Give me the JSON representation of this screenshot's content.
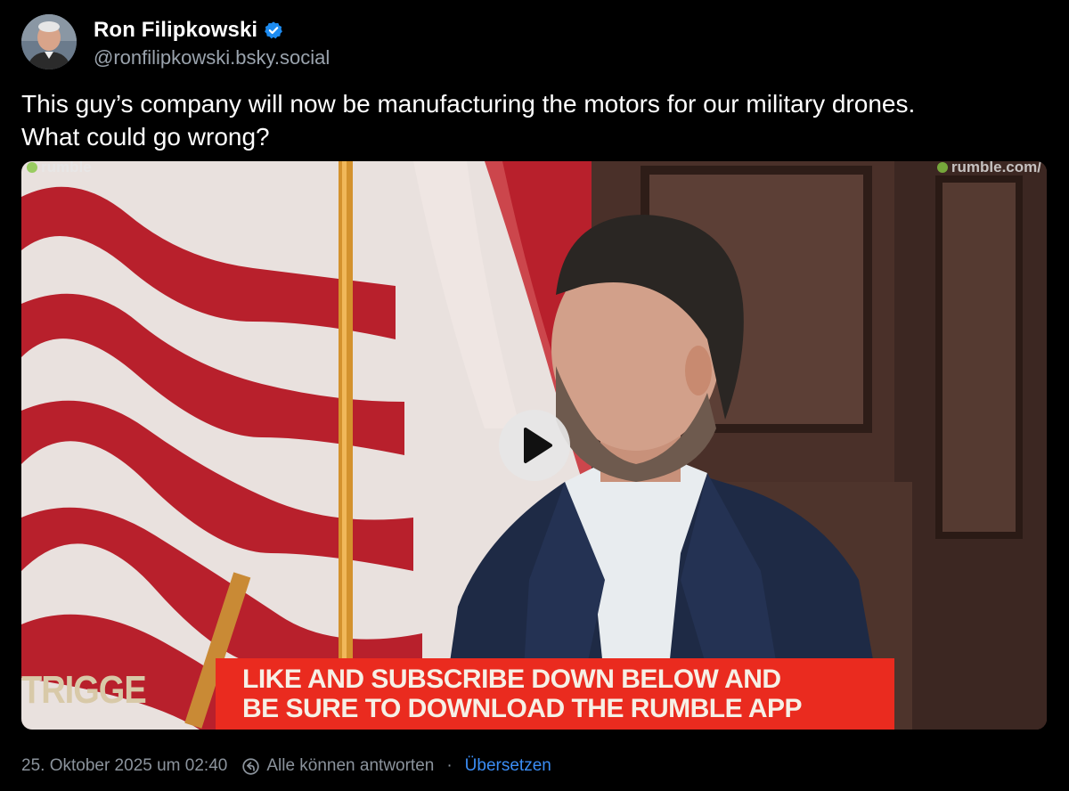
{
  "author": {
    "display_name": "Ron Filipkowski",
    "handle": "@ronfilipkowski.bsky.social",
    "verified": true,
    "avatar_icon": "profile-photo"
  },
  "post": {
    "text_line1": "This guy’s company will now be manufacturing the motors for our military drones.",
    "text_line2": "What could go wrong?"
  },
  "video": {
    "watermark_left": "rumble",
    "watermark_right": "rumble.com/",
    "lower_third_line1": "LIKE AND SUBSCRIBE DOWN BELOW AND",
    "lower_third_line2": "BE SURE TO DOWNLOAD THE RUMBLE APP",
    "brand_text": "TRIGGE",
    "play_icon": "play-icon"
  },
  "footer": {
    "timestamp": "25. Oktober 2025 um 02:40",
    "reply_setting": "Alle können antworten",
    "separator": "·",
    "translate": "Übersetzen"
  },
  "colors": {
    "background": "#000000",
    "text": "#ffffff",
    "muted": "#8b939c",
    "link": "#3b8df5",
    "verified": "#1d8bf0",
    "banner_red": "#ea2b1f"
  }
}
